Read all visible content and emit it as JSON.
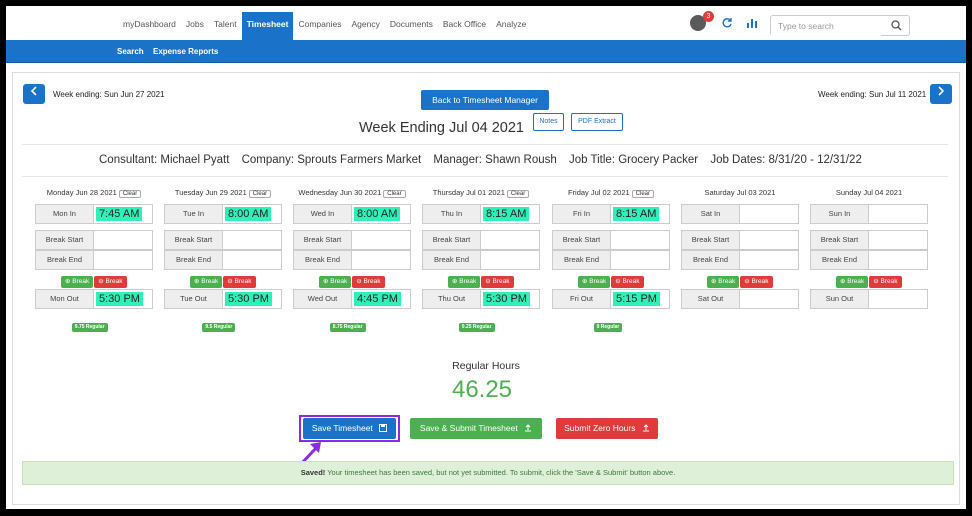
{
  "nav": {
    "items": [
      "myDashboard",
      "Jobs",
      "Talent",
      "Timesheet",
      "Companies",
      "Agency",
      "Documents",
      "Back Office",
      "Analyze"
    ],
    "active": "Timesheet",
    "notifications": "3",
    "search_placeholder": "Type to search"
  },
  "subnav": {
    "items": [
      "Search",
      "Expense Reports"
    ]
  },
  "week": {
    "prev_label": "Week ending: Sun Jun 27 2021",
    "next_label": "Week ending: Sun Jul 11 2021",
    "back_button": "Back to Timesheet Manager",
    "title": "Week Ending Jul 04 2021",
    "notes_button": "Notes",
    "pdf_button": "PDF Extract"
  },
  "info": {
    "consultant": "Consultant: Michael Pyatt",
    "company": "Company: Sprouts Farmers Market",
    "manager": "Manager: Shawn Roush",
    "job_title": "Job Title: Grocery Packer",
    "job_dates": "Job Dates: 8/31/20 - 12/31/22"
  },
  "labels": {
    "clear": "Clear",
    "break_start": "Break Start",
    "break_end": "Break End",
    "add_break": "Break",
    "remove_break": "Break"
  },
  "days": [
    {
      "head": "Monday Jun 28 2021",
      "clear": true,
      "in_label": "Mon In",
      "in": "7:45 AM",
      "out_label": "Mon Out",
      "out": "5:30 PM",
      "regular": "9.75 Regular"
    },
    {
      "head": "Tuesday Jun 29 2021",
      "clear": true,
      "in_label": "Tue In",
      "in": "8:00 AM",
      "out_label": "Tue Out",
      "out": "5:30 PM",
      "regular": "9.5 Regular"
    },
    {
      "head": "Wednesday Jun 30 2021",
      "clear": true,
      "in_label": "Wed In",
      "in": "8:00 AM",
      "out_label": "Wed Out",
      "out": "4:45 PM",
      "regular": "8.75 Regular"
    },
    {
      "head": "Thursday Jul 01 2021",
      "clear": true,
      "in_label": "Thu In",
      "in": "8:15 AM",
      "out_label": "Thu Out",
      "out": "5:30 PM",
      "regular": "9.25 Regular"
    },
    {
      "head": "Friday Jul 02 2021",
      "clear": true,
      "in_label": "Fri In",
      "in": "8:15 AM",
      "out_label": "Fri Out",
      "out": "5:15 PM",
      "regular": "9 Regular"
    },
    {
      "head": "Saturday Jul 03 2021",
      "clear": false,
      "in_label": "Sat In",
      "in": "",
      "out_label": "Sat Out",
      "out": "",
      "regular": ""
    },
    {
      "head": "Sunday Jul 04 2021",
      "clear": false,
      "in_label": "Sun In",
      "in": "",
      "out_label": "Sun Out",
      "out": "",
      "regular": ""
    }
  ],
  "totals": {
    "label": "Regular Hours",
    "value": "46.25"
  },
  "actions": {
    "save": "Save Timesheet",
    "save_submit": "Save & Submit Timesheet",
    "zero": "Submit Zero Hours"
  },
  "alert": {
    "strong": "Saved!",
    "text": " Your timesheet has been saved, but not yet submitted. To submit, click the 'Save & Submit' button above."
  },
  "colors": {
    "primary": "#1a73c8",
    "success": "#4caf50",
    "danger": "#e03a3a",
    "highlight": "#2ff0b8",
    "annotation": "#8a2be2"
  }
}
